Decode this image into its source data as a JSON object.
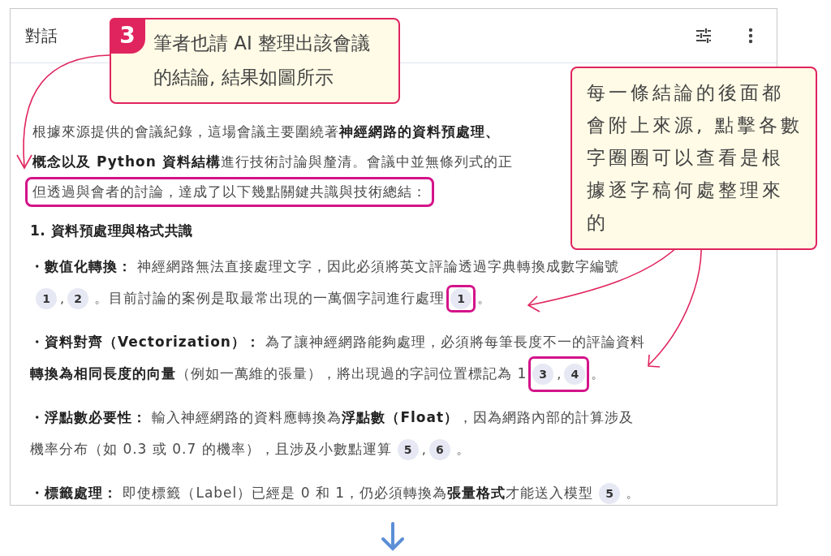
{
  "panel": {
    "title": "對話"
  },
  "intro": [
    {
      "text": "根據來源提供的會議紀錄，這場會議主要圍繞著**神經網路的資料預處理、**",
      "highlighted": false
    },
    {
      "text": "**概念以及 Python 資料結構**進行技術討論與釐清。會議中並無條列式的正",
      "highlighted": false
    },
    {
      "text": "但透過與會者的討論，達成了以下幾點關鍵共識與技術總結：",
      "highlighted": true
    }
  ],
  "section_heading": "1. 資料預處理與格式共識",
  "bullets": [
    {
      "label": "・數值化轉換：",
      "parts": [
        {
          "kind": "text",
          "text": "神經網路無法直接處理文字，因此必須將英文評論透過字典轉換成數字編號"
        },
        {
          "kind": "break"
        },
        {
          "kind": "cites",
          "highlighted": false,
          "items": [
            "1",
            "2"
          ],
          "separator": ","
        },
        {
          "kind": "text",
          "text": "。目前討論的案例是取最常出現的一萬個字詞進行處理"
        },
        {
          "kind": "cites",
          "highlighted": true,
          "items": [
            "1"
          ]
        },
        {
          "kind": "text",
          "text": "。"
        }
      ]
    },
    {
      "label": "・資料對齊（Vectorization）：",
      "parts": [
        {
          "kind": "text",
          "text": "為了讓神經網路能夠處理，必須將每筆長度不一的評論資料"
        },
        {
          "kind": "break"
        },
        {
          "kind": "text",
          "text": "**轉換為相同長度的向量**（例如一萬維的張量），將出現過的字詞位置標記為 1"
        },
        {
          "kind": "cites",
          "highlighted": true,
          "items": [
            "3",
            "4"
          ],
          "separator": ","
        },
        {
          "kind": "text",
          "text": "。"
        }
      ]
    },
    {
      "label": "・浮點數必要性：",
      "parts": [
        {
          "kind": "text",
          "text": "輸入神經網路的資料應轉換為**浮點數（Float）**，因為網路內部的計算涉及"
        },
        {
          "kind": "break"
        },
        {
          "kind": "text",
          "text": "機率分布（如 0.3 或 0.7 的機率），且涉及小數點運算"
        },
        {
          "kind": "cites",
          "highlighted": false,
          "items": [
            "5",
            "6"
          ],
          "separator": ","
        },
        {
          "kind": "text",
          "text": "。"
        }
      ]
    },
    {
      "label": "・標籤處理：",
      "parts": [
        {
          "kind": "text",
          "text": "即使標籤（Label）已經是 0 和 1，仍必須轉換為**張量格式**才能送入模型"
        },
        {
          "kind": "cites",
          "highlighted": false,
          "items": [
            "5"
          ]
        },
        {
          "kind": "text",
          "text": "。"
        }
      ]
    }
  ],
  "callouts": [
    {
      "number": "3",
      "text": "筆者也請 AI 整理出該會議的結論, 結果如圖所示"
    },
    {
      "text": "每一條結論的後面都會附上來源, 點擊各數字圈圈可以查看是根據逐字稿何處整理來的"
    }
  ]
}
